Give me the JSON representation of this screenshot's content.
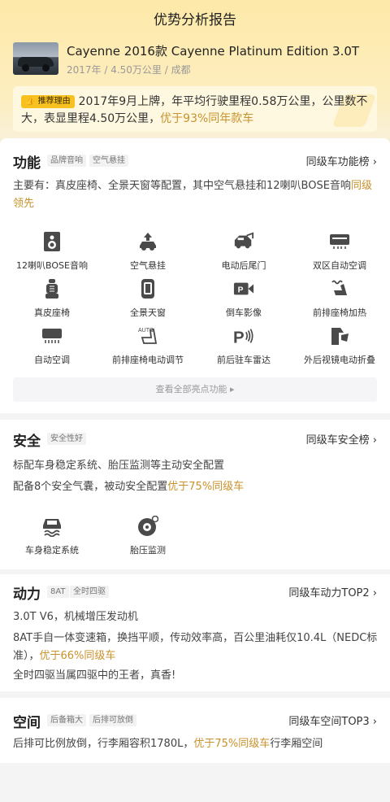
{
  "header": {
    "title": "优势分析报告"
  },
  "car": {
    "name": "Cayenne 2016款 Cayenne Platinum Edition 3.0T",
    "meta": "2017年 / 4.50万公里 / 成都"
  },
  "recommend": {
    "tag": "推荐理由",
    "text": "2017年9月上牌，年平均行驶里程0.58万公里，公里数不大，表显里程4.50万公里，",
    "highlight": "优于93%同年款车"
  },
  "function": {
    "title": "功能",
    "chips": [
      "品牌音响",
      "空气悬挂"
    ],
    "link": "同级车功能榜 ›",
    "desc": "主要有：真皮座椅、全景天窗等配置，其中空气悬挂和12喇叭BOSE音响",
    "desc_highlight": "同级领先",
    "items": [
      {
        "label": "12喇叭BOSE音响",
        "icon": "speaker-icon"
      },
      {
        "label": "空气悬挂",
        "icon": "air-suspension-icon"
      },
      {
        "label": "电动后尾门",
        "icon": "power-tailgate-icon"
      },
      {
        "label": "双区自动空调",
        "icon": "dual-zone-ac-icon"
      },
      {
        "label": "真皮座椅",
        "icon": "leather-seat-icon"
      },
      {
        "label": "全景天窗",
        "icon": "sunroof-icon"
      },
      {
        "label": "倒车影像",
        "icon": "rear-camera-icon"
      },
      {
        "label": "前排座椅加热",
        "icon": "seat-heating-icon"
      },
      {
        "label": "自动空调",
        "icon": "auto-ac-icon"
      },
      {
        "label": "前排座椅电动调节",
        "icon": "power-seat-icon"
      },
      {
        "label": "前后驻车雷达",
        "icon": "parking-radar-icon"
      },
      {
        "label": "外后视镜电动折叠",
        "icon": "mirror-fold-icon"
      }
    ],
    "more": "查看全部亮点功能 ▸"
  },
  "safety": {
    "title": "安全",
    "chips": [
      "安全性好"
    ],
    "link": "同级车安全榜 ›",
    "line1": "标配车身稳定系统、胎压监测等主动安全配置",
    "line2": "配备8个安全气囊，被动安全配置",
    "line2_highlight": "优于75%同级车",
    "items": [
      {
        "label": "车身稳定系统",
        "icon": "stability-control-icon"
      },
      {
        "label": "胎压监测",
        "icon": "tire-pressure-icon"
      }
    ]
  },
  "power": {
    "title": "动力",
    "chips": [
      "8AT",
      "全时四驱"
    ],
    "link": "同级车动力TOP2 ›",
    "line1": "3.0T V6，机械增压发动机",
    "line2": "8AT手自一体变速箱，换挡平顺，传动效率高，百公里油耗仅10.4L（NEDC标准），",
    "line2_highlight": "优于66%同级车",
    "line3": "全时四驱当属四驱中的王者，真香!"
  },
  "space": {
    "title": "空间",
    "chips": [
      "后备箱大",
      "后排可放倒"
    ],
    "link": "同级车空间TOP3 ›",
    "line1": "后排可比例放倒，行李厢容积1780L，",
    "line1_highlight": "优于75%同级车",
    "line1_tail": "行李厢空间"
  }
}
